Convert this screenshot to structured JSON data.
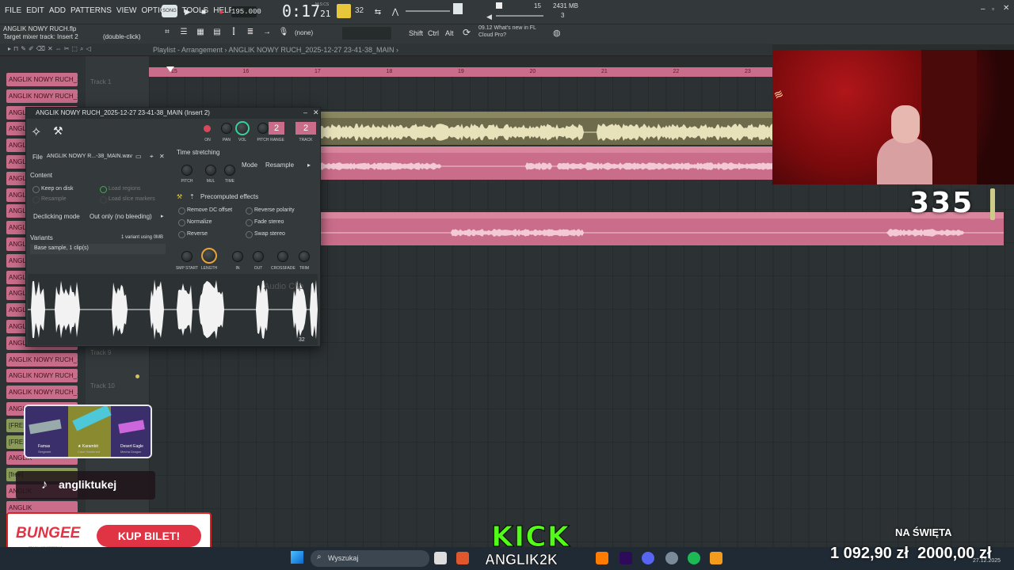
{
  "menu": [
    "FILE",
    "EDIT",
    "ADD",
    "PATTERNS",
    "VIEW",
    "OPTIONS",
    "TOOLS",
    "HELP"
  ],
  "transport": {
    "song_label": "SONG",
    "tempo": "195.000",
    "time_main": "0:17",
    "time_sub": "21",
    "mcs": "M:S:CS",
    "pattern_num": "32",
    "cpu": "15",
    "memory": "2431 MB",
    "voices": "3"
  },
  "hint": {
    "file": "ANGLIK NOWY RUCH.flp",
    "target": "Target mixer track: Insert 2",
    "dbl": "(double-click)"
  },
  "toolbar2": {
    "none_label": "(none)",
    "shift": "Shift",
    "ctrl": "Ctrl",
    "alt": "Alt",
    "news_time": "09.12",
    "news_text": "What's new in FL",
    "news_text2": "Cloud Pro?"
  },
  "breadcrumb": "Playlist - Arrangement › ANGLIK NOWY RUCH_2025-12-27 23-41-38_MAIN ›",
  "samples": [
    "ANGLIK NOWY RUCH_2025",
    "ANGLIK NOWY RUCH_2025",
    "ANGLIK NOWY RUCH_2025",
    "ANGLIK NOWY RUCH_2025",
    "ANGLIK NOWY RUCH_2025",
    "ANGLIK NOWY RUCH_2025",
    "ANGLIK NOWY RUCH_2025",
    "ANGLIK NOWY RUCH_2025",
    "ANGLIK NOWY RUCH_2025",
    "ANGLIK NOWY RUCH_2025",
    "ANGLIK NOWY RUCH_2025",
    "ANGLIK NOWY RUCH_2025",
    "ANGLIK NOWY RUCH_2025",
    "ANGLIK NOWY RUCH_2025",
    "ANGLIK NOWY RUCH_2025",
    "ANGLIK NOWY RUCH_2025",
    "ANGLIK NOWY RUCH_2025",
    "ANGLIK NOWY RUCH_2025",
    "ANGLIK NOWY RUCH_2025",
    "ANGLIK NOWY RUCH_2025",
    "ANGLIK NOWY RUCH_2025",
    "[FREE] Drum Type Beat",
    "[FREE]",
    "ANGLIK",
    "[free]",
    "ANGLIK",
    "ANGLIK"
  ],
  "tracks": [
    "Track 1",
    "Track 9",
    "Track 10"
  ],
  "timeline_ticks": [
    "15",
    "16",
    "17",
    "18",
    "19",
    "20",
    "21",
    "22",
    "23"
  ],
  "panel": {
    "title": "ANGLIK NOWY RUCH_2025-12-27 23-41-38_MAIN (Insert 2)",
    "knobs_top": [
      "ON",
      "PAN",
      "VOL",
      "PITCH",
      "RANGE",
      "TRACK"
    ],
    "range_val": "2",
    "track_val": "2",
    "file_label": "File",
    "file_name": "ANGLIK NOWY R...-38_MAIN.wav",
    "content": "Content",
    "keep_on_disk": "Keep on disk",
    "load_regions": "Load regions",
    "resample": "Resample",
    "load_slice": "Load slice markers",
    "declick_label": "Declicking mode",
    "declick_val": "Out only (no bleeding)",
    "variants": "Variants",
    "variants_info": "1 variant using 0MB",
    "base_sample": "Base sample, 1 clip(s)",
    "time_stretch": "Time stretching",
    "ts_knobs": [
      "PITCH",
      "MUL",
      "TIME"
    ],
    "mode_label": "Mode",
    "mode_val": "Resample",
    "precomp": "Precomputed effects",
    "effects": [
      "Remove DC offset",
      "Reverse polarity",
      "Normalize",
      "Fade stereo",
      "Reverse",
      "Swap stereo"
    ],
    "fx_knobs": [
      "SMP START",
      "LENGTH",
      "IN",
      "OUT",
      "CROSSFADE",
      "TRIM"
    ],
    "audio_clip": "Audio Clip",
    "zoom_val": "32"
  },
  "overlay": {
    "score": "335",
    "kick": "KICK",
    "kick_name": "ANGLIK2K",
    "na_swieta": "NA ŚWIĘTA",
    "money": "1 092,90 zł",
    "money_goal": "2000,00 zł",
    "tiktok": "angliktukej",
    "bungee": "BUNGEE",
    "kup": "KUP BILET!",
    "bungee_sub": "TRASA KONCERTOWA",
    "cs_items": [
      "Famas",
      "★ Karambit",
      "Desert Eagle"
    ],
    "cs_sub": [
      "Sergeant",
      "Case Hardened",
      "Mecha Dragon"
    ]
  },
  "taskbar": {
    "search": "Wyszukaj",
    "date": "27.12.2025"
  },
  "colors": {
    "clip": "#c96d8a",
    "accent": "#e8c83a",
    "kick": "#53fc18"
  }
}
